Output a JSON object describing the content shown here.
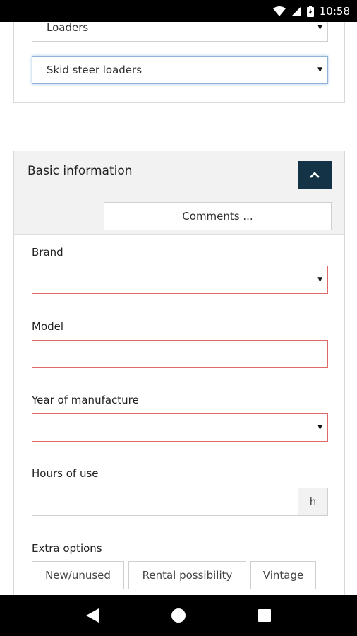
{
  "status_bar": {
    "time": "10:58"
  },
  "category": {
    "level1": "Loaders",
    "level2": "Skid steer loaders"
  },
  "basic_info": {
    "title": "Basic information",
    "comments_label": "Comments ...",
    "brand_label": "Brand",
    "brand_value": "",
    "model_label": "Model",
    "model_value": "",
    "year_label": "Year of manufacture",
    "year_value": "",
    "hours_label": "Hours of use",
    "hours_value": "",
    "hours_unit": "h",
    "extra_label": "Extra options",
    "extra_options": [
      "New/unused",
      "Rental possibility",
      "Vintage"
    ]
  },
  "colors": {
    "header_button": "#143346",
    "error_border": "#e06a6a",
    "focus_border": "#8fb3d9"
  }
}
